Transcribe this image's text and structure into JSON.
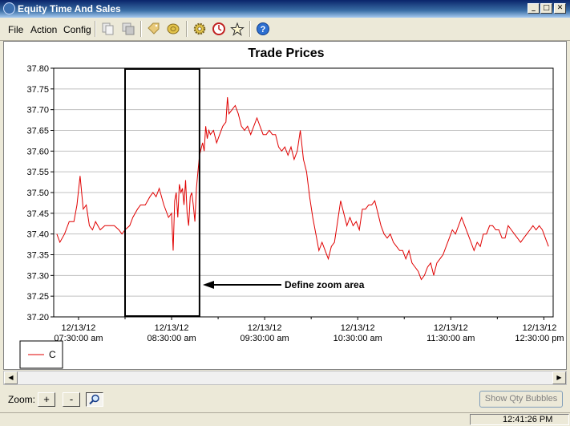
{
  "window": {
    "title": "Equity Time And Sales"
  },
  "menu": {
    "file": "File",
    "action": "Action",
    "config": "Config"
  },
  "toolbar": {
    "icons": [
      "copy-icon",
      "duplicate-icon",
      "tag-icon",
      "coin-icon",
      "gear-icon",
      "clock-icon",
      "star-icon",
      "help-icon"
    ]
  },
  "chart_data": {
    "type": "line",
    "title": "Trade Prices",
    "ylim": [
      37.2,
      37.8
    ],
    "yticks": [
      "37.20",
      "37.25",
      "37.30",
      "37.35",
      "37.40",
      "37.45",
      "37.50",
      "37.55",
      "37.60",
      "37.65",
      "37.70",
      "37.75",
      "37.80"
    ],
    "xticks": [
      {
        "date": "12/13/12",
        "time": "07:30:00 am"
      },
      {
        "date": "12/13/12",
        "time": "08:30:00 am"
      },
      {
        "date": "12/13/12",
        "time": "09:30:00 am"
      },
      {
        "date": "12/13/12",
        "time": "10:30:00 am"
      },
      {
        "date": "12/13/12",
        "time": "11:30:00 am"
      },
      {
        "date": "12/13/12",
        "time": "12:30:00 pm"
      }
    ],
    "grid": true,
    "legend_position": "bottom-left",
    "series": [
      {
        "name": "C",
        "color": "#e00000",
        "points": [
          [
            "07:16",
            37.4
          ],
          [
            "07:18",
            37.38
          ],
          [
            "07:21",
            37.4
          ],
          [
            "07:24",
            37.43
          ],
          [
            "07:27",
            37.43
          ],
          [
            "07:29",
            37.47
          ],
          [
            "07:31",
            37.54
          ],
          [
            "07:33",
            37.46
          ],
          [
            "07:35",
            37.47
          ],
          [
            "07:37",
            37.42
          ],
          [
            "07:39",
            37.41
          ],
          [
            "07:41",
            37.43
          ],
          [
            "07:44",
            37.41
          ],
          [
            "07:47",
            37.42
          ],
          [
            "07:50",
            37.42
          ],
          [
            "07:53",
            37.42
          ],
          [
            "07:56",
            37.41
          ],
          [
            "07:58",
            37.4
          ],
          [
            "08:00",
            37.41
          ],
          [
            "08:03",
            37.42
          ],
          [
            "08:05",
            37.44
          ],
          [
            "08:08",
            37.46
          ],
          [
            "08:10",
            37.47
          ],
          [
            "08:13",
            37.47
          ],
          [
            "08:16",
            37.49
          ],
          [
            "08:18",
            37.5
          ],
          [
            "08:20",
            37.49
          ],
          [
            "08:22",
            37.51
          ],
          [
            "08:25",
            37.47
          ],
          [
            "08:28",
            37.44
          ],
          [
            "08:30",
            37.45
          ],
          [
            "08:31",
            37.36
          ],
          [
            "08:32",
            37.48
          ],
          [
            "08:33",
            37.5
          ],
          [
            "08:34",
            37.44
          ],
          [
            "08:35",
            37.52
          ],
          [
            "08:36",
            37.5
          ],
          [
            "08:37",
            37.51
          ],
          [
            "08:38",
            37.47
          ],
          [
            "08:39",
            37.53
          ],
          [
            "08:40",
            37.45
          ],
          [
            "08:41",
            37.42
          ],
          [
            "08:42",
            37.49
          ],
          [
            "08:43",
            37.5
          ],
          [
            "08:44",
            37.47
          ],
          [
            "08:45",
            37.43
          ],
          [
            "08:46",
            37.51
          ],
          [
            "08:47",
            37.55
          ],
          [
            "08:48",
            37.59
          ],
          [
            "08:50",
            37.62
          ],
          [
            "08:51",
            37.6
          ],
          [
            "08:52",
            37.66
          ],
          [
            "08:53",
            37.63
          ],
          [
            "08:54",
            37.65
          ],
          [
            "08:55",
            37.64
          ],
          [
            "08:57",
            37.65
          ],
          [
            "08:59",
            37.62
          ],
          [
            "09:01",
            37.64
          ],
          [
            "09:03",
            37.66
          ],
          [
            "09:05",
            37.67
          ],
          [
            "09:06",
            37.73
          ],
          [
            "09:07",
            37.69
          ],
          [
            "09:09",
            37.7
          ],
          [
            "09:11",
            37.71
          ],
          [
            "09:13",
            37.69
          ],
          [
            "09:15",
            37.66
          ],
          [
            "09:17",
            37.65
          ],
          [
            "09:19",
            37.66
          ],
          [
            "09:21",
            37.64
          ],
          [
            "09:23",
            37.66
          ],
          [
            "09:25",
            37.68
          ],
          [
            "09:27",
            37.66
          ],
          [
            "09:29",
            37.64
          ],
          [
            "09:31",
            37.64
          ],
          [
            "09:33",
            37.65
          ],
          [
            "09:35",
            37.64
          ],
          [
            "09:37",
            37.64
          ],
          [
            "09:39",
            37.61
          ],
          [
            "09:41",
            37.6
          ],
          [
            "09:43",
            37.61
          ],
          [
            "09:45",
            37.59
          ],
          [
            "09:47",
            37.61
          ],
          [
            "09:49",
            37.58
          ],
          [
            "09:51",
            37.6
          ],
          [
            "09:53",
            37.65
          ],
          [
            "09:55",
            37.58
          ],
          [
            "09:57",
            37.55
          ],
          [
            "09:59",
            37.49
          ],
          [
            "10:01",
            37.44
          ],
          [
            "10:03",
            37.4
          ],
          [
            "10:05",
            37.36
          ],
          [
            "10:07",
            37.38
          ],
          [
            "10:09",
            37.36
          ],
          [
            "10:11",
            37.34
          ],
          [
            "10:13",
            37.37
          ],
          [
            "10:15",
            37.38
          ],
          [
            "10:17",
            37.43
          ],
          [
            "10:19",
            37.48
          ],
          [
            "10:21",
            37.45
          ],
          [
            "10:23",
            37.42
          ],
          [
            "10:25",
            37.44
          ],
          [
            "10:27",
            37.42
          ],
          [
            "10:29",
            37.43
          ],
          [
            "10:31",
            37.41
          ],
          [
            "10:33",
            37.46
          ],
          [
            "10:35",
            37.46
          ],
          [
            "10:37",
            37.47
          ],
          [
            "10:39",
            37.47
          ],
          [
            "10:41",
            37.48
          ],
          [
            "10:43",
            37.45
          ],
          [
            "10:45",
            37.42
          ],
          [
            "10:47",
            37.4
          ],
          [
            "10:49",
            37.39
          ],
          [
            "10:51",
            37.4
          ],
          [
            "10:53",
            37.38
          ],
          [
            "10:55",
            37.37
          ],
          [
            "10:57",
            37.36
          ],
          [
            "10:59",
            37.36
          ],
          [
            "11:01",
            37.34
          ],
          [
            "11:03",
            37.36
          ],
          [
            "11:05",
            37.33
          ],
          [
            "11:07",
            37.32
          ],
          [
            "11:09",
            37.31
          ],
          [
            "11:11",
            37.29
          ],
          [
            "11:13",
            37.3
          ],
          [
            "11:15",
            37.32
          ],
          [
            "11:17",
            37.33
          ],
          [
            "11:19",
            37.3
          ],
          [
            "11:21",
            37.33
          ],
          [
            "11:23",
            37.34
          ],
          [
            "11:25",
            37.35
          ],
          [
            "11:27",
            37.37
          ],
          [
            "11:29",
            37.39
          ],
          [
            "11:31",
            37.41
          ],
          [
            "11:33",
            37.4
          ],
          [
            "11:35",
            37.42
          ],
          [
            "11:37",
            37.44
          ],
          [
            "11:39",
            37.42
          ],
          [
            "11:41",
            37.4
          ],
          [
            "11:43",
            37.38
          ],
          [
            "11:45",
            37.36
          ],
          [
            "11:47",
            37.38
          ],
          [
            "11:49",
            37.37
          ],
          [
            "11:51",
            37.4
          ],
          [
            "11:53",
            37.4
          ],
          [
            "11:55",
            37.42
          ],
          [
            "11:57",
            37.42
          ],
          [
            "11:59",
            37.41
          ],
          [
            "12:01",
            37.41
          ],
          [
            "12:03",
            37.39
          ],
          [
            "12:05",
            37.39
          ],
          [
            "12:07",
            37.42
          ],
          [
            "12:09",
            37.41
          ],
          [
            "12:11",
            37.4
          ],
          [
            "12:13",
            37.39
          ],
          [
            "12:15",
            37.38
          ],
          [
            "12:17",
            37.39
          ],
          [
            "12:19",
            37.4
          ],
          [
            "12:21",
            37.41
          ],
          [
            "12:23",
            37.42
          ],
          [
            "12:25",
            37.41
          ],
          [
            "12:27",
            37.42
          ],
          [
            "12:29",
            37.41
          ],
          [
            "12:31",
            37.39
          ],
          [
            "12:33",
            37.37
          ]
        ]
      }
    ]
  },
  "zoom_area": {
    "start": "08:00",
    "end": "08:48"
  },
  "annotation": {
    "text": "Define zoom area"
  },
  "zoom": {
    "label": "Zoom:",
    "plus": "+",
    "minus": "-"
  },
  "buttons": {
    "show_qty": "Show Qty Bubbles"
  },
  "status": {
    "time": "12:41:26 PM"
  }
}
